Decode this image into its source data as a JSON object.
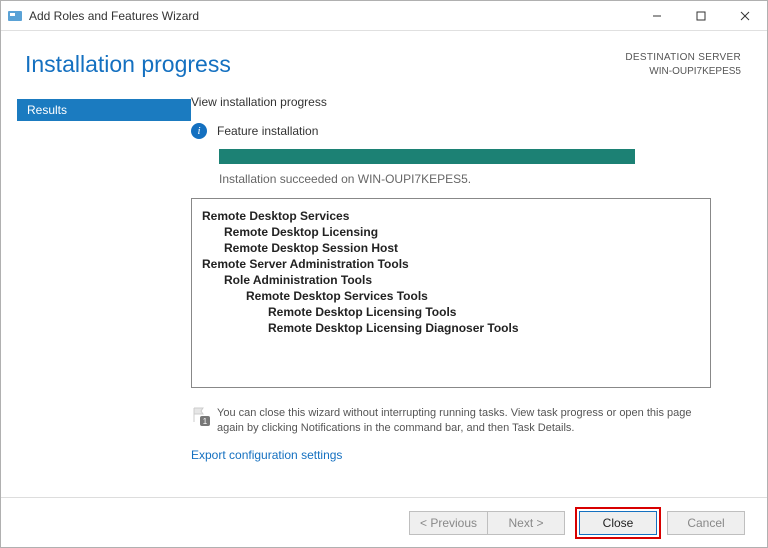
{
  "window": {
    "title": "Add Roles and Features Wizard"
  },
  "header": {
    "page_title": "Installation progress",
    "dest_label": "DESTINATION SERVER",
    "dest_server": "WIN-OUPI7KEPES5"
  },
  "sidebar": {
    "item": "Results"
  },
  "main": {
    "view_label": "View installation progress",
    "feature_label": "Feature installation",
    "status_message": "Installation succeeded on WIN-OUPI7KEPES5.",
    "features": {
      "a": "Remote Desktop Services",
      "a1": "Remote Desktop Licensing",
      "a2": "Remote Desktop Session Host",
      "b": "Remote Server Administration Tools",
      "b1": "Role Administration Tools",
      "b2": "Remote Desktop Services Tools",
      "b3a": "Remote Desktop Licensing Tools",
      "b3b": "Remote Desktop Licensing Diagnoser Tools"
    },
    "flag_text": "You can close this wizard without interrupting running tasks. View task progress or open this page again by clicking Notifications in the command bar, and then Task Details.",
    "export_link": "Export configuration settings"
  },
  "footer": {
    "previous": "< Previous",
    "next": "Next >",
    "close": "Close",
    "cancel": "Cancel"
  }
}
